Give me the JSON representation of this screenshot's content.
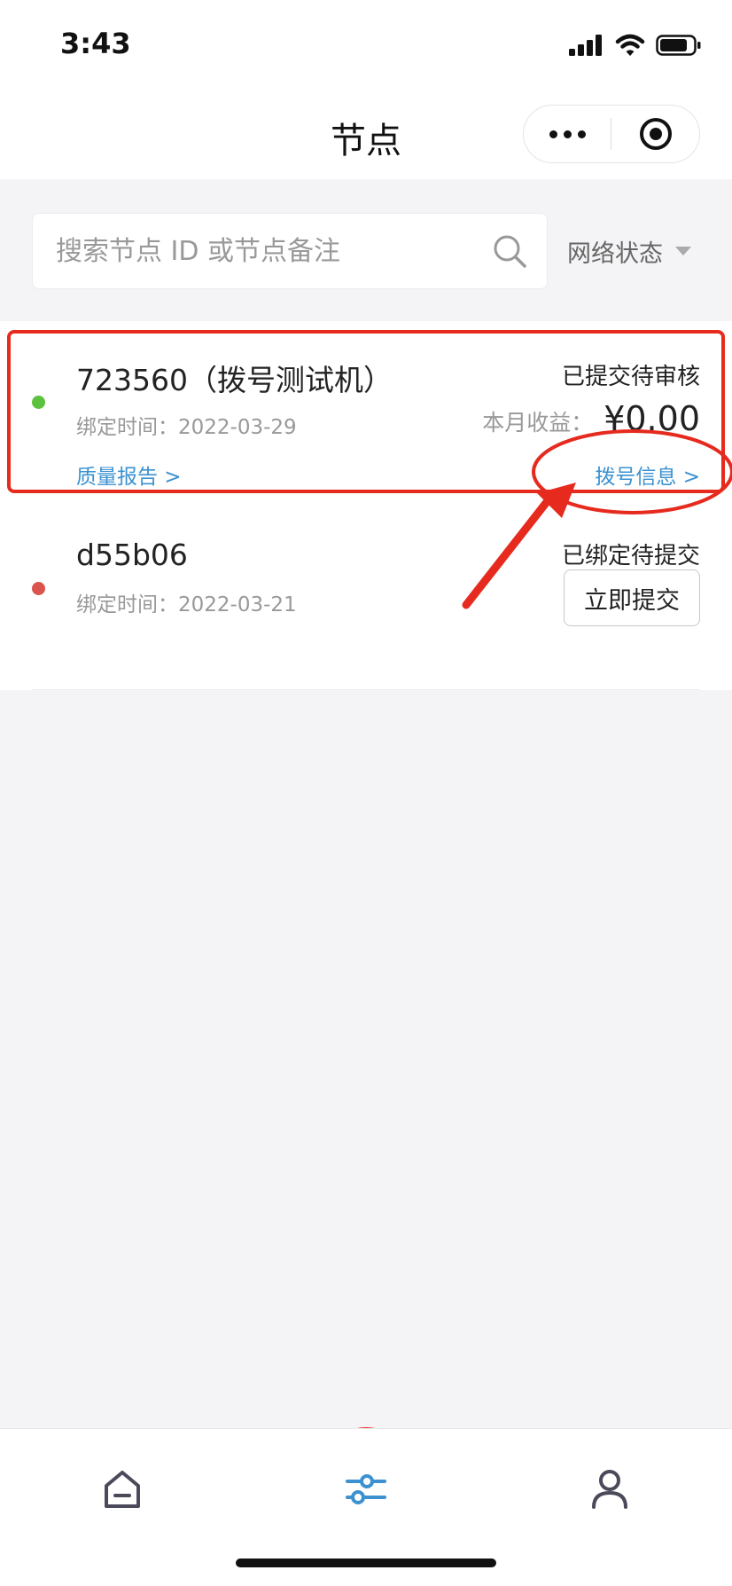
{
  "status_bar": {
    "time": "3:43"
  },
  "header": {
    "title": "节点"
  },
  "search": {
    "placeholder": "搜索节点 ID 或节点备注",
    "filter_label": "网络状态"
  },
  "nodes": [
    {
      "id_label": "723560（拨号测试机）",
      "bind_time": "绑定时间：2022-03-29",
      "status": "已提交待审核",
      "status_color": "#5cc13c",
      "earnings_label": "本月收益：",
      "earnings_value": "¥0.00",
      "quality_link": "质量报告 >",
      "dial_link": "拨号信息 >"
    },
    {
      "id_label": "d55b06",
      "bind_time": "绑定时间：2022-03-21",
      "status": "已绑定待提交",
      "status_color": "#d9534f",
      "action_button": "立即提交"
    }
  ],
  "tab_bar": {
    "tabs": [
      {
        "name": "home-icon",
        "active": false
      },
      {
        "name": "sliders-icon",
        "active": true
      },
      {
        "name": "person-icon",
        "active": false
      }
    ],
    "active_color": "#3c92d0",
    "inactive_color": "#4a4a5a"
  },
  "annotation_color": "#e62a1e"
}
